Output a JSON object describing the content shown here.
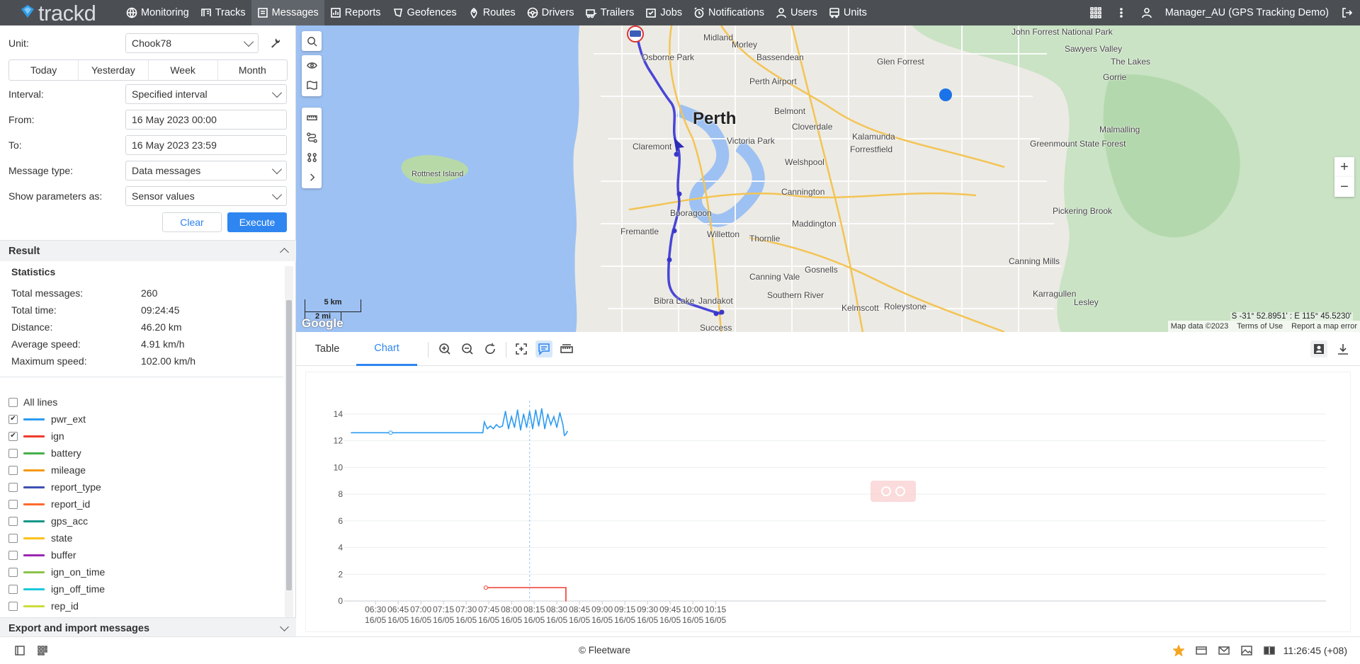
{
  "app": {
    "logo": "trackd"
  },
  "nav": [
    {
      "label": "Monitoring",
      "icon": "globe-icon"
    },
    {
      "label": "Tracks",
      "icon": "track-icon"
    },
    {
      "label": "Messages",
      "icon": "message-icon",
      "active": true
    },
    {
      "label": "Reports",
      "icon": "report-icon"
    },
    {
      "label": "Geofences",
      "icon": "geofence-icon"
    },
    {
      "label": "Routes",
      "icon": "route-icon"
    },
    {
      "label": "Drivers",
      "icon": "steering-wheel-icon"
    },
    {
      "label": "Trailers",
      "icon": "trailer-icon"
    },
    {
      "label": "Jobs",
      "icon": "job-icon"
    },
    {
      "label": "Notifications",
      "icon": "alarm-icon"
    },
    {
      "label": "Users",
      "icon": "user-icon"
    },
    {
      "label": "Units",
      "icon": "bus-icon"
    }
  ],
  "user": {
    "name": "Manager_AU (GPS Tracking Demo)"
  },
  "form": {
    "unit_label": "Unit:",
    "unit_value": "Chook78",
    "periods": [
      "Today",
      "Yesterday",
      "Week",
      "Month"
    ],
    "interval_label": "Interval:",
    "interval_value": "Specified interval",
    "from_label": "From:",
    "from_value": "16 May 2023 00:00",
    "to_label": "To:",
    "to_value": "16 May 2023 23:59",
    "msgtype_label": "Message type:",
    "msgtype_value": "Data messages",
    "params_label": "Show parameters as:",
    "params_value": "Sensor values",
    "clear": "Clear",
    "execute": "Execute"
  },
  "result": {
    "title": "Result",
    "stats_title": "Statistics",
    "stats": [
      {
        "label": "Total messages:",
        "value": "260"
      },
      {
        "label": "Total time:",
        "value": "09:24:45"
      },
      {
        "label": "Distance:",
        "value": "46.20 km"
      },
      {
        "label": "Average speed:",
        "value": "4.91 km/h"
      },
      {
        "label": "Maximum speed:",
        "value": "102.00 km/h"
      }
    ]
  },
  "lines": {
    "all_label": "All lines",
    "items": [
      {
        "label": "pwr_ext",
        "color": "#2d9bf0",
        "checked": true
      },
      {
        "label": "ign",
        "color": "#ee3b2d",
        "checked": true
      },
      {
        "label": "battery",
        "color": "#47b04b",
        "checked": false
      },
      {
        "label": "mileage",
        "color": "#f59a0e",
        "checked": false
      },
      {
        "label": "report_type",
        "color": "#3f51b5",
        "checked": false
      },
      {
        "label": "report_id",
        "color": "#ff6a30",
        "checked": false
      },
      {
        "label": "gps_acc",
        "color": "#139688",
        "checked": false
      },
      {
        "label": "state",
        "color": "#fcc21b",
        "checked": false
      },
      {
        "label": "buffer",
        "color": "#9c27b0",
        "checked": false
      },
      {
        "label": "ign_on_time",
        "color": "#8bc34a",
        "checked": false
      },
      {
        "label": "ign_off_time",
        "color": "#1ec8dc",
        "checked": false
      },
      {
        "label": "rep_id",
        "color": "#cddc39",
        "checked": false
      }
    ]
  },
  "export": {
    "title": "Export and import messages"
  },
  "map": {
    "labels": [
      {
        "text": "Perth",
        "big": true
      },
      {
        "text": "Midland"
      },
      {
        "text": "Morley"
      },
      {
        "text": "Bassendean"
      },
      {
        "text": "Osborne Park"
      },
      {
        "text": "Perth Airport"
      },
      {
        "text": "Belmont"
      },
      {
        "text": "Cloverdale"
      },
      {
        "text": "Victoria Park"
      },
      {
        "text": "Claremont"
      },
      {
        "text": "Welshpool"
      },
      {
        "text": "Kalamunda"
      },
      {
        "text": "Forrestfield"
      },
      {
        "text": "Rottnest Island"
      },
      {
        "text": "Cannington"
      },
      {
        "text": "Booragoon"
      },
      {
        "text": "Fremantle"
      },
      {
        "text": "Willetton"
      },
      {
        "text": "Thornlie"
      },
      {
        "text": "Maddington"
      },
      {
        "text": "Gosnells"
      },
      {
        "text": "Canning Vale"
      },
      {
        "text": "Southern River"
      },
      {
        "text": "Bibra Lake"
      },
      {
        "text": "Jandakot"
      },
      {
        "text": "Kelmscott"
      },
      {
        "text": "Roleystone"
      },
      {
        "text": "Success"
      },
      {
        "text": "Glen Forrest"
      },
      {
        "text": "Sawyers Valley"
      },
      {
        "text": "The Lakes"
      },
      {
        "text": "Gorrie"
      },
      {
        "text": "Malmalling"
      },
      {
        "text": "Greenmount State Forest"
      },
      {
        "text": "Pickering Brook"
      },
      {
        "text": "Canning Mills"
      },
      {
        "text": "Karragullen"
      },
      {
        "text": "Lesley"
      },
      {
        "text": "John Forrest National Park"
      }
    ],
    "scale_km": "5 km",
    "scale_mi": "2 mi",
    "google": "Google",
    "coords": "S -31° 52.8951' : E 115° 45.5230'",
    "attrib": [
      "Map data ©2023",
      "Terms of Use",
      "Report a map error"
    ],
    "zoom_in": "+",
    "zoom_out": "−"
  },
  "tabs": {
    "table": "Table",
    "chart": "Chart"
  },
  "chart_data": {
    "type": "line",
    "title": "",
    "xlabel": "",
    "ylabel": "",
    "ylim": [
      0,
      15
    ],
    "yticks": [
      0,
      2,
      4,
      6,
      8,
      10,
      12,
      14
    ],
    "xticks": [
      "06:30",
      "06:45",
      "07:00",
      "07:15",
      "07:30",
      "07:45",
      "08:00",
      "08:15",
      "08:30",
      "08:45",
      "09:00",
      "09:15",
      "09:30",
      "09:45",
      "10:00",
      "10:15"
    ],
    "xtick_date": "16/05",
    "x_range_minutes": [
      374,
      1019
    ],
    "series": [
      {
        "name": "pwr_ext",
        "color": "#2d9bf0",
        "x": [
          "06:14",
          "06:40",
          "07:10",
          "07:40",
          "07:41",
          "07:42",
          "07:44",
          "07:46",
          "07:48",
          "07:50",
          "07:52",
          "07:54",
          "07:56",
          "07:58",
          "08:00",
          "08:02",
          "08:04",
          "08:06",
          "08:08",
          "08:10",
          "08:12",
          "08:14",
          "08:16",
          "08:18",
          "08:20",
          "08:22",
          "08:24",
          "08:26",
          "08:28",
          "08:30",
          "08:32",
          "08:34",
          "08:35",
          "08:36",
          "08:37"
        ],
        "values": [
          12.6,
          12.6,
          12.6,
          12.6,
          12.6,
          13.4,
          12.9,
          13.1,
          12.9,
          13.2,
          13.0,
          13.1,
          14.2,
          12.9,
          13.8,
          13.0,
          14.3,
          12.8,
          14.0,
          13.0,
          14.2,
          12.9,
          14.3,
          13.1,
          14.4,
          12.9,
          14.0,
          13.2,
          13.8,
          13.0,
          14.1,
          13.2,
          12.4,
          12.5,
          12.7
        ]
      },
      {
        "name": "ign",
        "color": "#ee3b2d",
        "x": [
          "07:43",
          "08:36",
          "08:36"
        ],
        "values": [
          1,
          1,
          0
        ]
      }
    ],
    "cursor_x": "08:12"
  },
  "footer": {
    "copyright": "© Fleetware",
    "clock": "11:26:45 (+08)"
  }
}
